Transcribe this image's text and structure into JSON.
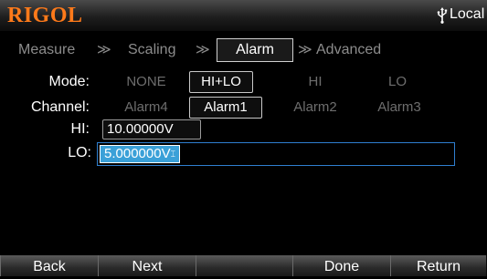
{
  "titlebar": {
    "brand": "RIGOL",
    "status": "Local",
    "usb_icon": "usb-icon"
  },
  "breadcrumb": {
    "items": [
      "Measure",
      "Scaling",
      "Alarm",
      "Advanced"
    ],
    "active": "Alarm",
    "separator": "≫"
  },
  "mode": {
    "label": "Mode:",
    "options": [
      "NONE",
      "HI+LO",
      "HI",
      "LO"
    ],
    "selected": "HI+LO"
  },
  "channel": {
    "label": "Channel:",
    "options": [
      "Alarm4",
      "Alarm1",
      "Alarm2",
      "Alarm3"
    ],
    "selected": "Alarm1"
  },
  "hi": {
    "label": "HI:",
    "value": "10.00000V"
  },
  "lo": {
    "label": "LO:",
    "value": "5.000000V"
  },
  "softkeys": [
    "Back",
    "Next",
    "",
    "Done",
    "Return"
  ],
  "colors": {
    "brand": "#ff7a1a",
    "edit_highlight": "#3aa0d8",
    "edit_border": "#2f7fd0",
    "inactive_text": "#6e6e6e"
  }
}
